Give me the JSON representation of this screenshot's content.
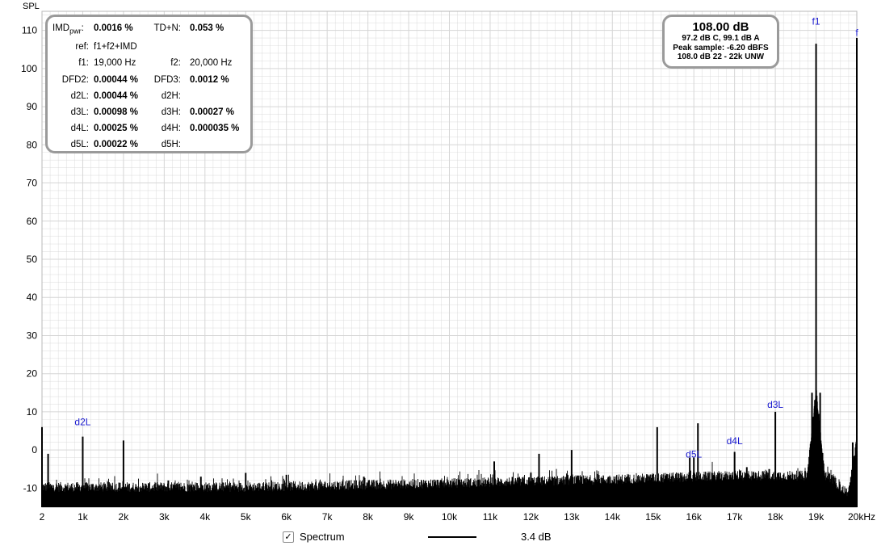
{
  "chart_data": {
    "type": "line",
    "title": "",
    "ylabel": "SPL",
    "xlabel": "",
    "xlim": [
      0,
      20000
    ],
    "ylim": [
      -15,
      115
    ],
    "x_unit": "kHz",
    "grid": true,
    "y_ticks": [
      110,
      100,
      90,
      80,
      70,
      60,
      50,
      40,
      30,
      20,
      10,
      0,
      -10
    ],
    "x_ticks": [
      {
        "value": 0,
        "label": "2"
      },
      {
        "value": 1000,
        "label": "1k"
      },
      {
        "value": 2000,
        "label": "2k"
      },
      {
        "value": 3000,
        "label": "3k"
      },
      {
        "value": 4000,
        "label": "4k"
      },
      {
        "value": 5000,
        "label": "5k"
      },
      {
        "value": 6000,
        "label": "6k"
      },
      {
        "value": 7000,
        "label": "7k"
      },
      {
        "value": 8000,
        "label": "8k"
      },
      {
        "value": 9000,
        "label": "9k"
      },
      {
        "value": 10000,
        "label": "10k"
      },
      {
        "value": 11000,
        "label": "11k"
      },
      {
        "value": 12000,
        "label": "12k"
      },
      {
        "value": 13000,
        "label": "13k"
      },
      {
        "value": 14000,
        "label": "14k"
      },
      {
        "value": 15000,
        "label": "15k"
      },
      {
        "value": 16000,
        "label": "16k"
      },
      {
        "value": 17000,
        "label": "17k"
      },
      {
        "value": 18000,
        "label": "18k"
      },
      {
        "value": 19000,
        "label": "19k"
      },
      {
        "value": 20000,
        "label": "20kHz"
      }
    ],
    "series": [
      {
        "name": "Spectrum",
        "color": "#000000",
        "noise_floor": [
          [
            0,
            -11
          ],
          [
            5000,
            -11
          ],
          [
            10000,
            -10
          ],
          [
            14000,
            -9
          ],
          [
            17000,
            -8
          ],
          [
            18700,
            -8
          ],
          [
            19300,
            -8
          ],
          [
            19700,
            -12
          ],
          [
            20000,
            -14
          ]
        ],
        "peaks": [
          {
            "x": 0,
            "y": 6
          },
          {
            "x": 150,
            "y": -1
          },
          {
            "x": 1000,
            "y": 3.5
          },
          {
            "x": 2000,
            "y": 2.5
          },
          {
            "x": 3100,
            "y": -8
          },
          {
            "x": 3900,
            "y": -7
          },
          {
            "x": 5000,
            "y": -6
          },
          {
            "x": 6000,
            "y": -6.5
          },
          {
            "x": 7900,
            "y": -7
          },
          {
            "x": 11100,
            "y": -3
          },
          {
            "x": 12000,
            "y": -6
          },
          {
            "x": 12200,
            "y": -1
          },
          {
            "x": 12900,
            "y": -6.5
          },
          {
            "x": 13000,
            "y": 0
          },
          {
            "x": 15100,
            "y": 6
          },
          {
            "x": 15200,
            "y": -7
          },
          {
            "x": 15900,
            "y": -2
          },
          {
            "x": 16000,
            "y": -2
          },
          {
            "x": 16100,
            "y": 7
          },
          {
            "x": 16900,
            "y": -6.5
          },
          {
            "x": 17000,
            "y": -0.5
          },
          {
            "x": 17300,
            "y": -4.5
          },
          {
            "x": 17600,
            "y": -7
          },
          {
            "x": 17850,
            "y": -5
          },
          {
            "x": 18000,
            "y": 10
          },
          {
            "x": 18200,
            "y": -6.5
          },
          {
            "x": 18900,
            "y": 15
          },
          {
            "x": 19000,
            "y": 106.5
          },
          {
            "x": 19100,
            "y": 15
          },
          {
            "x": 19900,
            "y": 2
          },
          {
            "x": 20000,
            "y": 108
          }
        ],
        "skirts": [
          {
            "x0": 18780,
            "x1": 19220,
            "center": 19000,
            "top": 15
          },
          {
            "x0": 19780,
            "x1": 20000,
            "center": 20000,
            "top": 2
          }
        ]
      }
    ],
    "annotations": [
      {
        "label": "f1",
        "x": 19000,
        "y": 111.5
      },
      {
        "label": "f",
        "x": 20000,
        "y": 108.5
      },
      {
        "label": "d2L",
        "x": 1000,
        "y": 6.5
      },
      {
        "label": "d3L",
        "x": 18000,
        "y": 11
      },
      {
        "label": "d4L",
        "x": 17000,
        "y": 1.5
      },
      {
        "label": "d5L",
        "x": 16000,
        "y": -2
      }
    ]
  },
  "readout": {
    "imd_label_main": "IMD",
    "imd_label_sub": "pwr",
    "imd_label_colon": ":",
    "imd_value": "0.0016 %",
    "tdn_label": "TD+N:",
    "tdn_value": "0.053 %",
    "ref_label": "ref:",
    "ref_value": "f1+f2+IMD",
    "f1_label": "f1:",
    "f1_value": "19,000 Hz",
    "f2_label": "f2:",
    "f2_value": "20,000 Hz",
    "dfd2_label": "DFD2:",
    "dfd2_value": "0.00044 %",
    "dfd3_label": "DFD3:",
    "dfd3_value": "0.0012 %",
    "d2l_label": "d2L:",
    "d2l_value": "0.00044 %",
    "d2h_label": "d2H:",
    "d3l_label": "d3L:",
    "d3l_value": "0.00098 %",
    "d3h_label": "d3H:",
    "d3h_value": "0.00027 %",
    "d4l_label": "d4L:",
    "d4l_value": "0.00025 %",
    "d4h_label": "d4H:",
    "d4h_value": "0.000035 %",
    "d5l_label": "d5L:",
    "d5l_value": "0.00022 %",
    "d5h_label": "d5H:"
  },
  "spl_box": {
    "main": "108.00 dB",
    "line1": "97.2 dB C, 99.1 dB A",
    "line2": "Peak sample: -6.20 dBFS",
    "line3": "108.0 dB 22 - 22k UNW"
  },
  "legend": {
    "checkbox_mark": "✓",
    "spectrum_label": "Spectrum",
    "smoothing": "3.4 dB"
  },
  "colors": {
    "annotation": "#1a1ad0",
    "grid": "#d6d6d6",
    "frame": "#9a9a9a",
    "trace": "#000000"
  }
}
